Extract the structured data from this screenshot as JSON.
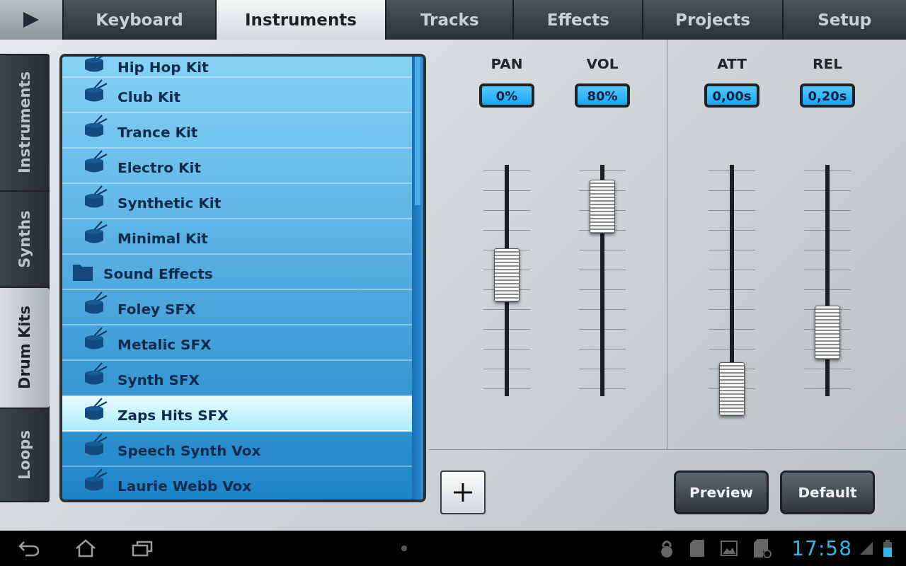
{
  "top_tabs": [
    {
      "label": "Keyboard",
      "selected": false
    },
    {
      "label": "Instruments",
      "selected": true
    },
    {
      "label": "Tracks",
      "selected": false
    },
    {
      "label": "Effects",
      "selected": false
    },
    {
      "label": "Projects",
      "selected": false
    },
    {
      "label": "Setup",
      "selected": false
    }
  ],
  "side_tabs": [
    {
      "label": "Instruments",
      "selected": false
    },
    {
      "label": "Synths",
      "selected": false
    },
    {
      "label": "Drum Kits",
      "selected": true
    },
    {
      "label": "Loops",
      "selected": false
    }
  ],
  "instrument_list": [
    {
      "kind": "kit",
      "label": "Hip Hop Kit",
      "selected": false
    },
    {
      "kind": "kit",
      "label": "Club Kit",
      "selected": false
    },
    {
      "kind": "kit",
      "label": "Trance Kit",
      "selected": false
    },
    {
      "kind": "kit",
      "label": "Electro Kit",
      "selected": false
    },
    {
      "kind": "kit",
      "label": "Synthetic Kit",
      "selected": false
    },
    {
      "kind": "kit",
      "label": "Minimal Kit",
      "selected": false
    },
    {
      "kind": "folder",
      "label": "Sound Effects",
      "selected": false
    },
    {
      "kind": "kit",
      "label": "Foley SFX",
      "selected": false
    },
    {
      "kind": "kit",
      "label": "Metalic SFX",
      "selected": false
    },
    {
      "kind": "kit",
      "label": "Synth SFX",
      "selected": false
    },
    {
      "kind": "kit",
      "label": "Zaps Hits SFX",
      "selected": true
    },
    {
      "kind": "kit",
      "label": "Speech Synth Vox",
      "selected": false
    },
    {
      "kind": "kit",
      "label": "Laurie Webb Vox",
      "selected": false
    }
  ],
  "fader_groups": [
    {
      "faders": [
        {
          "label": "PAN",
          "value": "0%",
          "level": 0.5
        },
        {
          "label": "VOL",
          "value": "80%",
          "level": 0.8
        }
      ]
    },
    {
      "faders": [
        {
          "label": "ATT",
          "value": "0,00s",
          "level": 0
        },
        {
          "label": "REL",
          "value": "0,20s",
          "level": 0.25
        }
      ]
    }
  ],
  "buttons": [
    {
      "label": "Preview"
    },
    {
      "label": "Default"
    }
  ],
  "status_bar": {
    "time": "17:58"
  }
}
